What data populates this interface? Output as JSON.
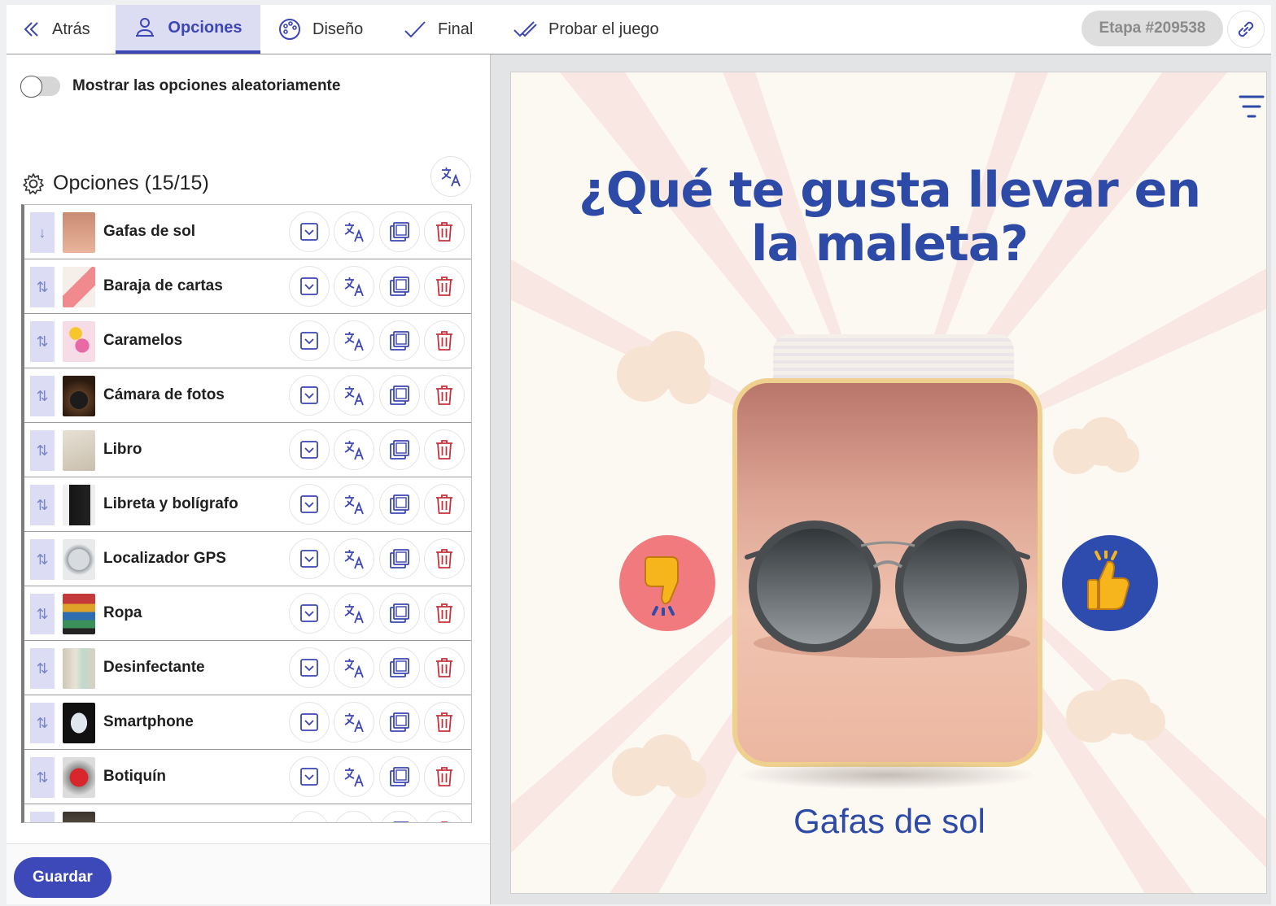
{
  "nav": {
    "back_label": "Atrás",
    "tabs": [
      {
        "label": "Opciones",
        "active": true
      },
      {
        "label": "Diseño",
        "active": false
      },
      {
        "label": "Final",
        "active": false
      },
      {
        "label": "Probar el juego",
        "active": false
      }
    ],
    "stage_label": "Etapa #209538"
  },
  "options_panel": {
    "shuffle_label": "Mostrar las opciones aleatoriamente",
    "shuffle_on": false,
    "heading": "Opciones (15/15)",
    "items": [
      {
        "label": "Gafas de sol",
        "thumb": "sunglasses"
      },
      {
        "label": "Baraja de cartas",
        "thumb": "cards"
      },
      {
        "label": "Caramelos",
        "thumb": "candy"
      },
      {
        "label": "Cámara de fotos",
        "thumb": "camera"
      },
      {
        "label": "Libro",
        "thumb": "book"
      },
      {
        "label": "Libreta y bolígrafo",
        "thumb": "notebook"
      },
      {
        "label": "Localizador GPS",
        "thumb": "gps-tracker"
      },
      {
        "label": "Ropa",
        "thumb": "clothes"
      },
      {
        "label": "Desinfectante",
        "thumb": "sanitizer"
      },
      {
        "label": "Smartphone",
        "thumb": "smartphone"
      },
      {
        "label": "Botiquín",
        "thumb": "first-aid-kit"
      },
      {
        "label": "",
        "thumb": "partial"
      }
    ],
    "save_label": "Guardar"
  },
  "preview": {
    "question": "¿Qué te gusta llevar en la maleta?",
    "current_option": "Gafas de sol",
    "dislike_icon": "thumbs-down-icon",
    "like_icon": "thumbs-up-icon"
  },
  "colors": {
    "accent": "#3d48b9",
    "tab_active_bg": "#dcdcf3",
    "question_text": "#2d4aa6",
    "dislike_bg": "#f07a7d",
    "like_bg": "#2e4bae",
    "delete_icon": "#c8323c"
  }
}
